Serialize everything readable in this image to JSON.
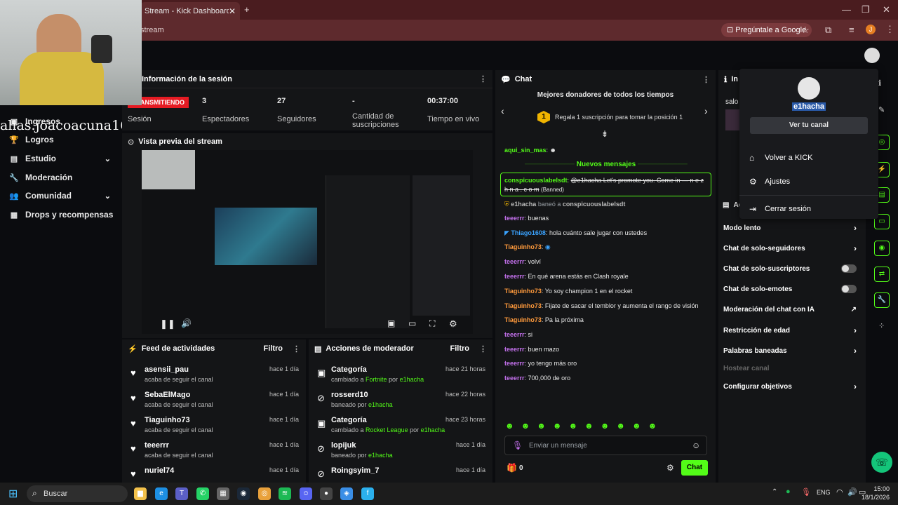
{
  "browser": {
    "tab_title": "Stream - Kick Dashboard",
    "url": "stream",
    "gemini_label": "Pregúntale a Google",
    "profile_initial": "J"
  },
  "sidebar": {
    "items": [
      {
        "label": "Ingresos",
        "icon": "money-icon"
      },
      {
        "label": "Logros",
        "icon": "trophy-icon"
      },
      {
        "label": "Estudio",
        "icon": "studio-icon"
      },
      {
        "label": "Moderación",
        "icon": "wrench-icon"
      },
      {
        "label": "Comunidad",
        "icon": "community-icon"
      },
      {
        "label": "Drops y recompensas",
        "icon": "drops-icon"
      }
    ]
  },
  "watermark": "alias.joacoacuna16",
  "session": {
    "title": "Información de la sesión",
    "live_badge": "TRANSMITIENDO",
    "live_label": "Sesión",
    "stats": [
      {
        "value": "3",
        "label": "Espectadores"
      },
      {
        "value": "27",
        "label": "Seguidores"
      },
      {
        "value": "-",
        "label": "Cantidad de suscripciones"
      },
      {
        "value": "00:37:00",
        "label": "Tiempo en vivo"
      }
    ]
  },
  "preview": {
    "title": "Vista previa del stream"
  },
  "activity": {
    "title": "Feed de actividades",
    "filter": "Filtro",
    "rows": [
      {
        "name": "asensii_pau",
        "sub": "acaba de seguir el canal",
        "time": "hace 1 día"
      },
      {
        "name": "SebaElMago",
        "sub": "acaba de seguir el canal",
        "time": "hace 1 día"
      },
      {
        "name": "Tiaguinho73",
        "sub": "acaba de seguir el canal",
        "time": "hace 1 día"
      },
      {
        "name": "teeerrr",
        "sub": "acaba de seguir el canal",
        "time": "hace 1 día"
      },
      {
        "name": "nuriel74",
        "sub": "",
        "time": "hace 1 día"
      }
    ]
  },
  "modactions": {
    "title": "Acciones de moderador",
    "filter": "Filtro",
    "rows": [
      {
        "name": "Categoría",
        "sub_pre": "cambiado a ",
        "sub_hl": "Fortnite",
        "sub_mid": " por ",
        "sub_by": "e1hacha",
        "time": "hace 21 horas"
      },
      {
        "name": "rosserd10",
        "sub_pre": "baneado por ",
        "sub_hl": "",
        "sub_mid": "",
        "sub_by": "e1hacha",
        "time": "hace 22 horas"
      },
      {
        "name": "Categoría",
        "sub_pre": "cambiado a ",
        "sub_hl": "Rocket League",
        "sub_mid": " por ",
        "sub_by": "e1hacha",
        "time": "hace 23 horas"
      },
      {
        "name": "lopijuk",
        "sub_pre": "baneado por ",
        "sub_hl": "",
        "sub_mid": "",
        "sub_by": "e1hacha",
        "time": "hace 1 día"
      },
      {
        "name": "Roingsyim_7",
        "sub_pre": "",
        "sub_hl": "",
        "sub_mid": "",
        "sub_by": "",
        "time": "hace 1 día"
      }
    ]
  },
  "chat": {
    "title": "Chat",
    "donors_title": "Mejores donadores de todos los tiempos",
    "donors_rank": "1",
    "donors_text": "Regala 1 suscripción para tomar la posición 1",
    "first_user": "aqui_sin_mas",
    "new_messages": "Nuevos mensajes",
    "banned_user": "conspicuouslabelsdt",
    "banned_text": "@e1hacha Let's promote you. Come in — n e z h n a . c o m",
    "banned_tag": "(Banned)",
    "ban_notice_user": "e1hacha",
    "ban_notice_mid": "baneó a",
    "ban_notice_target": "conspicuouslabelsdt",
    "messages": [
      {
        "user": "teeerrr",
        "color": "#c471ed",
        "text": "buenas"
      },
      {
        "user": "Thiago1608",
        "color": "#3aa3ff",
        "text": "hola cuánto sale jugar con ustedes"
      },
      {
        "user": "Tiaguinho73",
        "color": "#ff9a3c",
        "text": ""
      },
      {
        "user": "teeerrr",
        "color": "#c471ed",
        "text": "volví"
      },
      {
        "user": "teeerrr",
        "color": "#c471ed",
        "text": "En qué arena estás en Clash royale"
      },
      {
        "user": "Tiaguinho73",
        "color": "#ff9a3c",
        "text": "Yo soy champion 1 en el rocket"
      },
      {
        "user": "Tiaguinho73",
        "color": "#ff9a3c",
        "text": "Fijate de sacar el temblor y aumenta el rango de visión"
      },
      {
        "user": "Tiaguinho73",
        "color": "#ff9a3c",
        "text": "Pa la próxima"
      },
      {
        "user": "teeerrr",
        "color": "#c471ed",
        "text": "si"
      },
      {
        "user": "teeerrr",
        "color": "#c471ed",
        "text": "buen mazo"
      },
      {
        "user": "teeerrr",
        "color": "#c471ed",
        "text": "yo tengo más oro"
      },
      {
        "user": "teeerrr",
        "color": "#c471ed",
        "text": "700,000 de oro"
      }
    ],
    "input_placeholder": "Enviar un mensaje",
    "gift_count": "0",
    "send_label": "Chat"
  },
  "modpanel": {
    "title": "Acciones",
    "top_title": "In",
    "top_label": "salo",
    "rows": [
      {
        "label": "Modo lento",
        "kind": "chevron"
      },
      {
        "label": "Chat de solo-seguidores",
        "kind": "chevron"
      },
      {
        "label": "Chat de solo-suscriptores",
        "kind": "toggle"
      },
      {
        "label": "Chat de solo-emotes",
        "kind": "toggle"
      },
      {
        "label": "Moderación del chat con IA",
        "kind": "external"
      },
      {
        "label": "Restricción de edad",
        "kind": "chevron"
      },
      {
        "label": "Palabras baneadas",
        "kind": "chevron"
      },
      {
        "label": "Hostear canal",
        "kind": "disabled"
      },
      {
        "label": "Configurar objetivos",
        "kind": "chevron"
      }
    ]
  },
  "dropdown": {
    "username": "e1hacha",
    "channel_button": "Ver tu canal",
    "items": [
      {
        "label": "Volver a KICK",
        "icon": "home-icon"
      },
      {
        "label": "Ajustes",
        "icon": "gear-icon"
      },
      {
        "label": "Cerrar sesión",
        "icon": "logout-icon"
      }
    ]
  },
  "taskbar": {
    "search_placeholder": "Buscar",
    "lang": "ENG",
    "time": "15:00",
    "date": "18/1/2026"
  },
  "colors": {
    "accent": "#53fc18",
    "live": "#e51b23",
    "chrome_tabbar": "#4a1c1f",
    "panel": "#141517"
  }
}
